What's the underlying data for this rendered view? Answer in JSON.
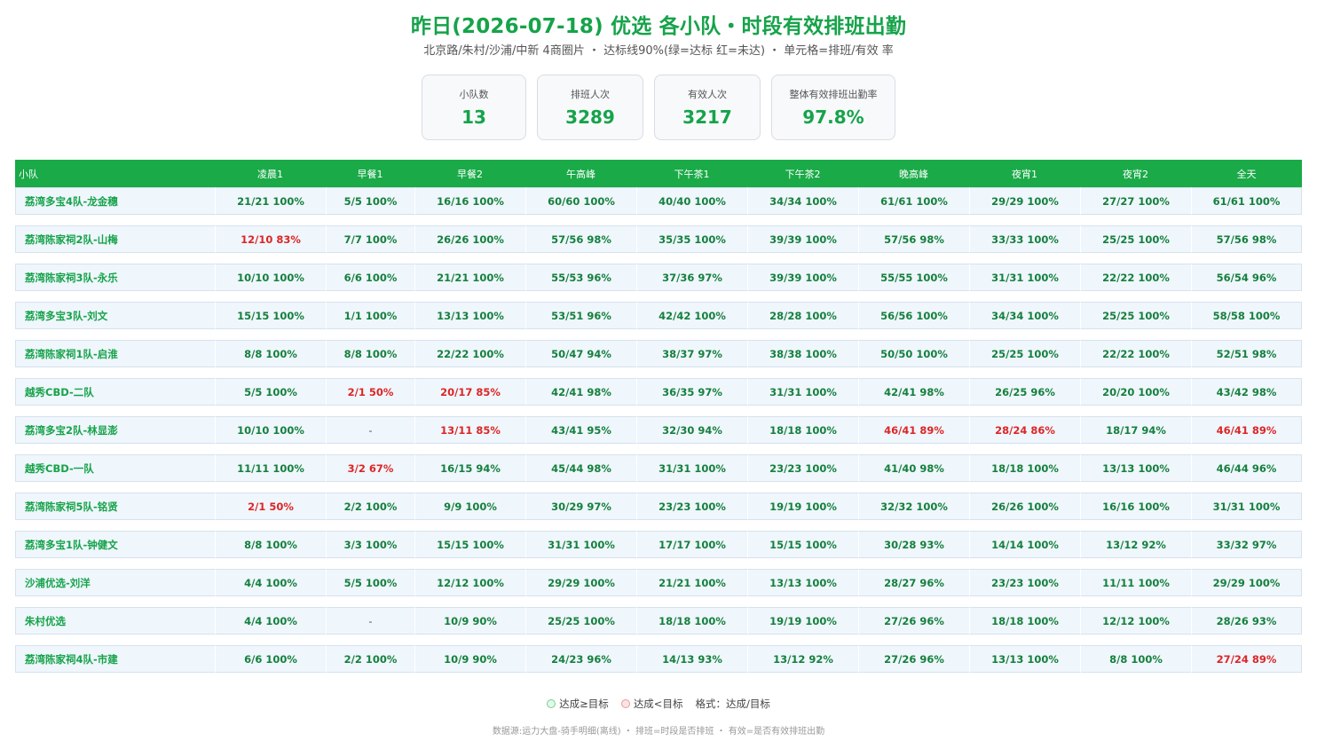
{
  "header": {
    "title": "昨日(2026-07-18) 优选 各小队・时段有效排班出勤",
    "subtitle": "北京路/朱村/沙浦/中新 4商圈片 ・ 达标线90%(绿=达标 红=未达) ・ 单元格=排班/有效 率"
  },
  "kpis": [
    {
      "label": "小队数",
      "value": "13"
    },
    {
      "label": "排班人次",
      "value": "3289"
    },
    {
      "label": "有效人次",
      "value": "3217"
    },
    {
      "label": "整体有效排班出勤率",
      "value": "97.8%"
    }
  ],
  "chart_data": {
    "type": "table",
    "threshold_percent": 90,
    "colors": {
      "ok": "#15803d",
      "bad": "#dc2626",
      "header_bg": "#1aaa48"
    },
    "columns": [
      "小队",
      "凌晨1",
      "早餐1",
      "早餐2",
      "午高峰",
      "下午茶1",
      "下午茶2",
      "晚高峰",
      "夜宵1",
      "夜宵2",
      "全天"
    ],
    "rows": [
      {
        "name": "荔湾多宝4队-龙金穗",
        "cells": [
          "21/21 100%",
          "5/5 100%",
          "16/16 100%",
          "60/60 100%",
          "40/40 100%",
          "34/34 100%",
          "61/61 100%",
          "29/29 100%",
          "27/27 100%",
          "61/61 100%"
        ],
        "below": [
          false,
          false,
          false,
          false,
          false,
          false,
          false,
          false,
          false,
          false
        ]
      },
      {
        "name": "荔湾陈家祠2队-山梅",
        "cells": [
          "12/10 83%",
          "7/7 100%",
          "26/26 100%",
          "57/56 98%",
          "35/35 100%",
          "39/39 100%",
          "57/56 98%",
          "33/33 100%",
          "25/25 100%",
          "57/56 98%"
        ],
        "below": [
          true,
          false,
          false,
          false,
          false,
          false,
          false,
          false,
          false,
          false
        ]
      },
      {
        "name": "荔湾陈家祠3队-永乐",
        "cells": [
          "10/10 100%",
          "6/6 100%",
          "21/21 100%",
          "55/53 96%",
          "37/36 97%",
          "39/39 100%",
          "55/55 100%",
          "31/31 100%",
          "22/22 100%",
          "56/54 96%"
        ],
        "below": [
          false,
          false,
          false,
          false,
          false,
          false,
          false,
          false,
          false,
          false
        ]
      },
      {
        "name": "荔湾多宝3队-刘文",
        "cells": [
          "15/15 100%",
          "1/1 100%",
          "13/13 100%",
          "53/51 96%",
          "42/42 100%",
          "28/28 100%",
          "56/56 100%",
          "34/34 100%",
          "25/25 100%",
          "58/58 100%"
        ],
        "below": [
          false,
          false,
          false,
          false,
          false,
          false,
          false,
          false,
          false,
          false
        ]
      },
      {
        "name": "荔湾陈家祠1队-启淮",
        "cells": [
          "8/8 100%",
          "8/8 100%",
          "22/22 100%",
          "50/47 94%",
          "38/37 97%",
          "38/38 100%",
          "50/50 100%",
          "25/25 100%",
          "22/22 100%",
          "52/51 98%"
        ],
        "below": [
          false,
          false,
          false,
          false,
          false,
          false,
          false,
          false,
          false,
          false
        ]
      },
      {
        "name": "越秀CBD-二队",
        "cells": [
          "5/5 100%",
          "2/1 50%",
          "20/17 85%",
          "42/41 98%",
          "36/35 97%",
          "31/31 100%",
          "42/41 98%",
          "26/25 96%",
          "20/20 100%",
          "43/42 98%"
        ],
        "below": [
          false,
          true,
          true,
          false,
          false,
          false,
          false,
          false,
          false,
          false
        ]
      },
      {
        "name": "荔湾多宝2队-林显澎",
        "cells": [
          "10/10 100%",
          "-",
          "13/11 85%",
          "43/41 95%",
          "32/30 94%",
          "18/18 100%",
          "46/41 89%",
          "28/24 86%",
          "18/17 94%",
          "46/41 89%"
        ],
        "below": [
          false,
          false,
          true,
          false,
          false,
          false,
          true,
          true,
          false,
          true
        ]
      },
      {
        "name": "越秀CBD-一队",
        "cells": [
          "11/11 100%",
          "3/2 67%",
          "16/15 94%",
          "45/44 98%",
          "31/31 100%",
          "23/23 100%",
          "41/40 98%",
          "18/18 100%",
          "13/13 100%",
          "46/44 96%"
        ],
        "below": [
          false,
          true,
          false,
          false,
          false,
          false,
          false,
          false,
          false,
          false
        ]
      },
      {
        "name": "荔湾陈家祠5队-铭贤",
        "cells": [
          "2/1 50%",
          "2/2 100%",
          "9/9 100%",
          "30/29 97%",
          "23/23 100%",
          "19/19 100%",
          "32/32 100%",
          "26/26 100%",
          "16/16 100%",
          "31/31 100%"
        ],
        "below": [
          true,
          false,
          false,
          false,
          false,
          false,
          false,
          false,
          false,
          false
        ]
      },
      {
        "name": "荔湾多宝1队-钟健文",
        "cells": [
          "8/8 100%",
          "3/3 100%",
          "15/15 100%",
          "31/31 100%",
          "17/17 100%",
          "15/15 100%",
          "30/28 93%",
          "14/14 100%",
          "13/12 92%",
          "33/32 97%"
        ],
        "below": [
          false,
          false,
          false,
          false,
          false,
          false,
          false,
          false,
          false,
          false
        ]
      },
      {
        "name": "沙浦优选-刘洋",
        "cells": [
          "4/4 100%",
          "5/5 100%",
          "12/12 100%",
          "29/29 100%",
          "21/21 100%",
          "13/13 100%",
          "28/27 96%",
          "23/23 100%",
          "11/11 100%",
          "29/29 100%"
        ],
        "below": [
          false,
          false,
          false,
          false,
          false,
          false,
          false,
          false,
          false,
          false
        ]
      },
      {
        "name": "朱村优选",
        "cells": [
          "4/4 100%",
          "-",
          "10/9 90%",
          "25/25 100%",
          "18/18 100%",
          "19/19 100%",
          "27/26 96%",
          "18/18 100%",
          "12/12 100%",
          "28/26 93%"
        ],
        "below": [
          false,
          false,
          false,
          false,
          false,
          false,
          false,
          false,
          false,
          false
        ]
      },
      {
        "name": "荔湾陈家祠4队-市建",
        "cells": [
          "6/6 100%",
          "2/2 100%",
          "10/9 90%",
          "24/23 96%",
          "14/13 93%",
          "13/12 92%",
          "27/26 96%",
          "13/13 100%",
          "8/8 100%",
          "27/24 89%"
        ],
        "below": [
          false,
          false,
          false,
          false,
          false,
          false,
          false,
          false,
          false,
          true
        ]
      }
    ]
  },
  "legend": {
    "ok_label": "达成≥目标",
    "bad_label": "达成<目标",
    "format_label": "格式：达成/目标"
  },
  "footnote": "数据源:运力大盘-骑手明细(离线) ・ 排班=时段是否排班 ・ 有效=是否有效排班出勤"
}
